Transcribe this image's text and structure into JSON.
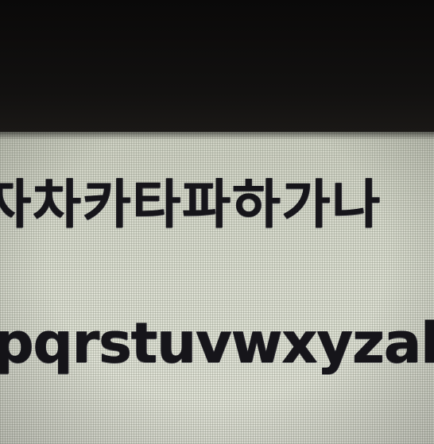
{
  "screen": {
    "korean_text": "자차카타파하가나",
    "latin_text": "pqrstuvwxyzabc"
  }
}
